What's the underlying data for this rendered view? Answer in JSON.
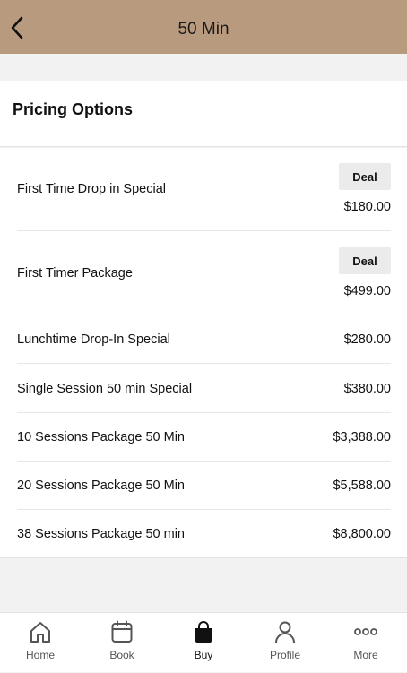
{
  "header": {
    "title": "50 Min"
  },
  "section": {
    "title": "Pricing Options"
  },
  "options": [
    {
      "name": "First Time Drop in Special",
      "price": "$180.00",
      "badge": "Deal"
    },
    {
      "name": "First Timer Package",
      "price": "$499.00",
      "badge": "Deal"
    },
    {
      "name": "Lunchtime Drop-In Special",
      "price": "$280.00"
    },
    {
      "name": "Single Session 50 min Special",
      "price": "$380.00"
    },
    {
      "name": "10 Sessions Package 50 Min",
      "price": "$3,388.00"
    },
    {
      "name": "20 Sessions Package 50 Min",
      "price": "$5,588.00"
    },
    {
      "name": "38 Sessions Package 50 min",
      "price": "$8,800.00"
    }
  ],
  "tabs": [
    {
      "label": "Home",
      "icon": "home-icon"
    },
    {
      "label": "Book",
      "icon": "calendar-icon"
    },
    {
      "label": "Buy",
      "icon": "shopping-bag-icon",
      "active": true
    },
    {
      "label": "Profile",
      "icon": "person-icon"
    },
    {
      "label": "More",
      "icon": "more-dots-icon"
    }
  ],
  "colors": {
    "header_bg": "#b89a7e",
    "page_bg": "#f2f2f2",
    "badge_bg": "#ebebeb"
  }
}
